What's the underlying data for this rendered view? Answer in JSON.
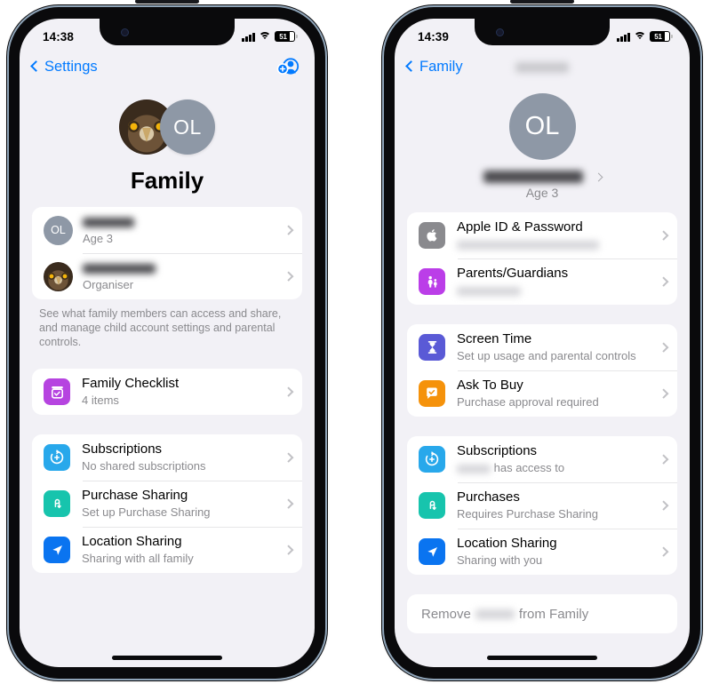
{
  "phones": [
    {
      "id": "family-overview",
      "status": {
        "time": "14:38",
        "battery_level": "51",
        "signal": "4-bars",
        "wifi": "wifi-icon"
      },
      "nav": {
        "back_label": "Settings",
        "title": "",
        "action_icon": "add-person-icon"
      },
      "hero": {
        "avatar_initials": "OL",
        "title": "Family"
      },
      "members": [
        {
          "avatar": "OL",
          "name_redacted": true,
          "name_width": 58,
          "subtitle": "Age 3"
        },
        {
          "avatar": "owl",
          "name_redacted": true,
          "name_width": 82,
          "subtitle": "Organiser"
        }
      ],
      "footnote": "See what family members can access and share, and manage child account settings and parental controls.",
      "groups": [
        {
          "rows": [
            {
              "icon": "checklist-icon",
              "icon_color": "#b644e0",
              "title": "Family Checklist",
              "subtitle": "4 items"
            }
          ]
        },
        {
          "rows": [
            {
              "icon": "subscriptions-icon",
              "icon_color": "#28a8eb",
              "title": "Subscriptions",
              "subtitle": "No shared subscriptions"
            },
            {
              "icon": "purchase-sharing-icon",
              "icon_color": "#17c4ad",
              "title": "Purchase Sharing",
              "subtitle": "Set up Purchase Sharing"
            },
            {
              "icon": "location-sharing-icon",
              "icon_color": "#0a74f0",
              "title": "Location Sharing",
              "subtitle": "Sharing with all family"
            }
          ]
        }
      ]
    },
    {
      "id": "family-member-detail",
      "status": {
        "time": "14:39",
        "battery_level": "51",
        "signal": "4-bars",
        "wifi": "wifi-icon"
      },
      "nav": {
        "back_label": "Family",
        "title_redacted": true,
        "title_width": 60
      },
      "hero": {
        "avatar_initials": "OL",
        "name_redacted": true,
        "name_width": 112,
        "age": "Age 3"
      },
      "groups": [
        {
          "rows": [
            {
              "icon": "apple-logo-icon",
              "icon_color": "#8a8a8e",
              "title": "Apple ID & Password",
              "subtitle_redacted": true,
              "subtitle_width": 160
            },
            {
              "icon": "parents-guardians-icon",
              "icon_color": "#bb3ee8",
              "title": "Parents/Guardians",
              "subtitle_redacted": true,
              "subtitle_width": 72
            }
          ]
        },
        {
          "rows": [
            {
              "icon": "screen-time-icon",
              "icon_color": "#5a5ad6",
              "title": "Screen Time",
              "subtitle": "Set up usage and parental controls"
            },
            {
              "icon": "ask-to-buy-icon",
              "icon_color": "#f5920b",
              "title": "Ask To Buy",
              "subtitle": "Purchase approval required"
            }
          ]
        },
        {
          "rows": [
            {
              "icon": "subscriptions-icon",
              "icon_color": "#28a8eb",
              "title": "Subscriptions",
              "subtitle_prefix_redacted": true,
              "subtitle_prefix_width": 38,
              "subtitle": "has access to"
            },
            {
              "icon": "purchase-sharing-icon",
              "icon_color": "#17c4ad",
              "title": "Purchases",
              "subtitle": "Requires Purchase Sharing"
            },
            {
              "icon": "location-sharing-icon",
              "icon_color": "#0a74f0",
              "title": "Location Sharing",
              "subtitle": "Sharing with you"
            }
          ]
        }
      ],
      "remove": {
        "prefix": "Remove",
        "name_redacted": true,
        "name_width": 44,
        "suffix": "from Family"
      }
    }
  ],
  "theme": {
    "accent_blue": "#027aff",
    "screen_bg": "#f2f1f6",
    "card_bg": "#ffffff",
    "secondary_text": "#8a8a8e"
  }
}
